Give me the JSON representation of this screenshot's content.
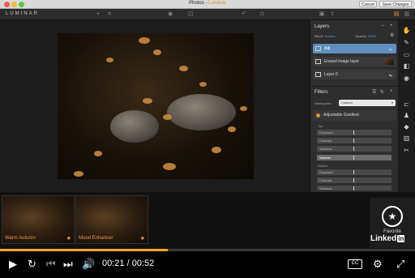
{
  "window": {
    "title_prefix": "Photos - ",
    "title_app": "Luminar",
    "cancel_label": "Cancel",
    "save_label": "Save Changes"
  },
  "toolbar": {
    "logo": "LUMINAR",
    "icons": [
      "plus-icon",
      "crop-icon",
      "eye-icon",
      "compare-icon",
      "undo-icon",
      "history-icon",
      "image-icon",
      "export-icon",
      "layout-icon"
    ]
  },
  "layers": {
    "title": "Layers",
    "blend_label": "Blend:",
    "blend_value": "Normal",
    "opacity_label": "Opacity:",
    "opacity_value": "100%",
    "items": [
      {
        "name": "Adj",
        "selected": true
      },
      {
        "name": "Erased image layer",
        "selected": false
      },
      {
        "name": "Layer 0",
        "selected": false
      }
    ]
  },
  "filters": {
    "title": "Filters",
    "workspace_label": "Workspace:",
    "workspace_value": "Custom",
    "filter_name": "Adjustable Gradient",
    "top_label": "Top",
    "top_sliders": [
      "Exposure",
      "Contrast",
      "Vibrance",
      "Warmth"
    ],
    "bottom_label": "Bottom",
    "bottom_sliders": [
      "Exposure",
      "Contrast",
      "Vibrance"
    ]
  },
  "presets": [
    {
      "name": "Warm Autumn"
    },
    {
      "name": "Mood Enhancer"
    }
  ],
  "favorite": {
    "label": "Favorite",
    "brand": "Linked",
    "brand_in": "in"
  },
  "player": {
    "current_time": "00:21",
    "separator": " / ",
    "duration": "00:52",
    "progress_fraction": 0.404,
    "cc_label": "CC"
  },
  "colors": {
    "accent": "#f5a623",
    "selection": "#5e8fbf",
    "workspace_link": "#4fa3e0"
  }
}
